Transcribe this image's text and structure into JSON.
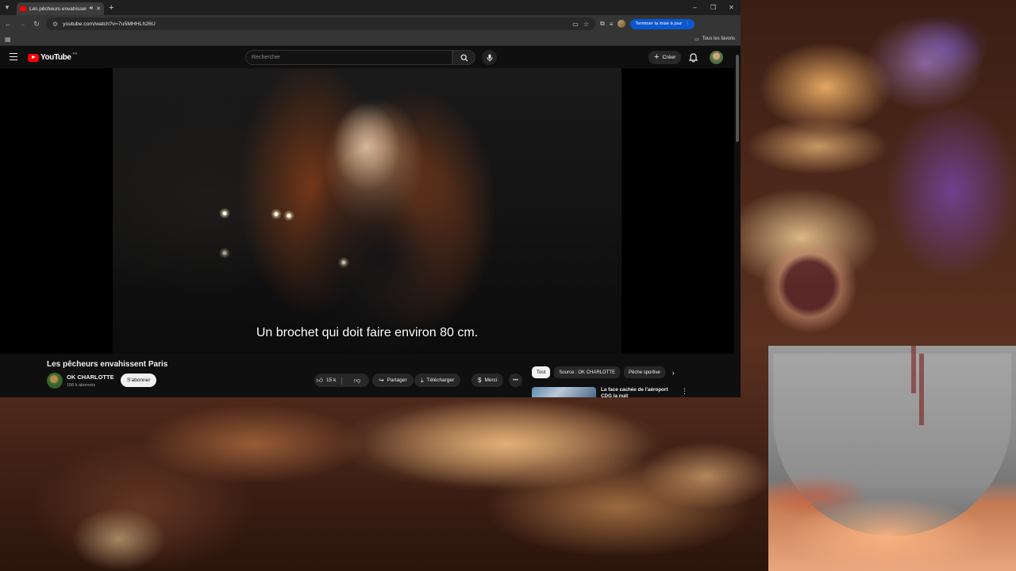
{
  "browser": {
    "tab_title": "Les pêcheurs envahissent Paris - YouTube",
    "url": "youtube.com/watch?v=7u5MHHLh26U",
    "update_button": "Terminer la mise à jour",
    "all_bookmarks": "Tous les favoris"
  },
  "youtube": {
    "logo_text": "YouTube",
    "logo_country": "FR",
    "search_placeholder": "Rechercher",
    "create_label": "Créer",
    "subtitle": "Un brochet qui doit faire environ 80 cm.",
    "video_title": "Les pêcheurs envahissent Paris",
    "channel_name": "OK CHARLOTTE",
    "subscribers": "156 k abonnés",
    "subscribe_label": "S'abonner",
    "like_count": "15 k",
    "share_label": "Partager",
    "download_label": "Télécharger",
    "thanks_label": "Merci",
    "chips": [
      "Tout",
      "Source : OK CHARLOTTE",
      "Pêche sportive"
    ],
    "recommendation_title": "La face cachée de l'aéroport CDG la nuit"
  },
  "colors": {
    "yt_red": "#ff0000",
    "update_blue": "#0b57d0",
    "page_bg": "#0f0f0f"
  }
}
